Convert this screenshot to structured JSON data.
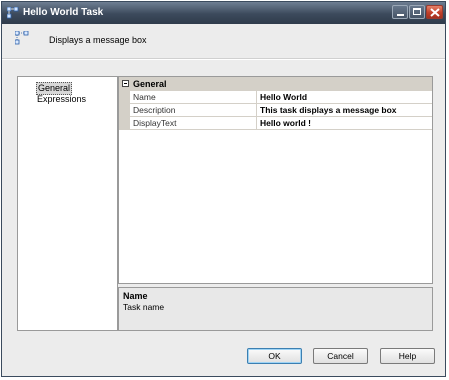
{
  "window": {
    "title": "Hello World Task",
    "description": "Displays a message box"
  },
  "nav": {
    "items": [
      {
        "label": "General",
        "selected": true
      },
      {
        "label": "Expressions",
        "selected": false
      }
    ]
  },
  "property_grid": {
    "category": "General",
    "expander_symbol": "−",
    "properties": [
      {
        "name": "Name",
        "value": "Hello World"
      },
      {
        "name": "Description",
        "value": "This task displays a message box"
      },
      {
        "name": "DisplayText",
        "value": "Hello world !"
      }
    ]
  },
  "description_pane": {
    "title": "Name",
    "text": "Task name"
  },
  "buttons": {
    "ok": "OK",
    "cancel": "Cancel",
    "help": "Help"
  },
  "colors": {
    "titlebar": "#3c4a5c",
    "close_button": "#c2402a",
    "window_bg": "#ececec",
    "category_bg": "#d4d0c8"
  }
}
